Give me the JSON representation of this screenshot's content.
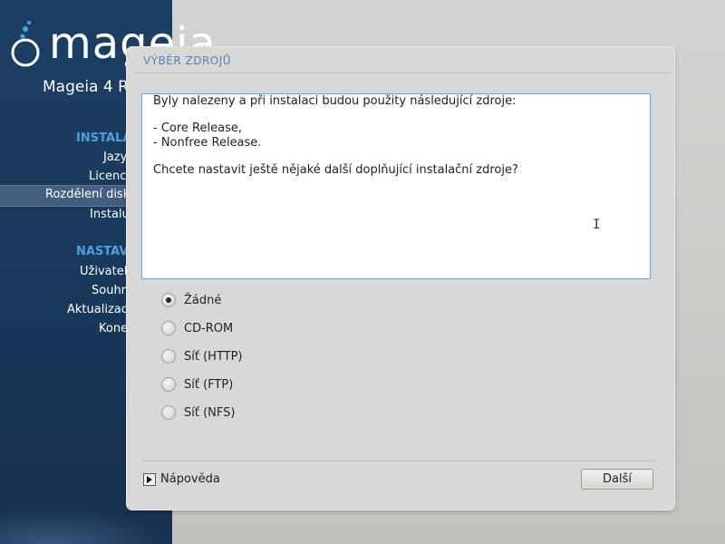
{
  "sidebar": {
    "logo_text": "mageia",
    "product_name": "Mageia 4 R",
    "sections": [
      {
        "title": "INSTALA",
        "items": [
          "Jazy",
          "Licenc",
          "Rozdělení disk",
          "Instalu"
        ]
      },
      {
        "title": "NASTAV",
        "items": [
          "Uživatel",
          "Souhr",
          "Aktualizac",
          "Kone"
        ]
      }
    ],
    "active_item": "Rozdělení disk"
  },
  "dialog": {
    "title": "VÝBĚR ZDROJŮ",
    "message": {
      "intro": "Byly nalezeny a při instalaci budou použity následující zdroje:",
      "sources": [
        "- Core Release,",
        "- Nonfree Release."
      ],
      "question": "Chcete nastavit ještě nějaké další doplňující instalační zdroje?"
    },
    "options": [
      {
        "label": "Žádné",
        "selected": true
      },
      {
        "label": "CD-ROM",
        "selected": false
      },
      {
        "label": "Síť (HTTP)",
        "selected": false
      },
      {
        "label": "Síť (FTP)",
        "selected": false
      },
      {
        "label": "Síť (NFS)",
        "selected": false
      }
    ],
    "help_label": "Nápověda",
    "next_label": "Další"
  },
  "colors": {
    "sidebar_bg": "#1d3f64",
    "section_heading": "#4aa3e0",
    "dialog_title": "#5a7fb5",
    "focus_border": "#6aa8e2"
  },
  "icons": [
    "mageia-cauldron-icon",
    "text-cursor-icon",
    "expander-arrow-icon"
  ]
}
